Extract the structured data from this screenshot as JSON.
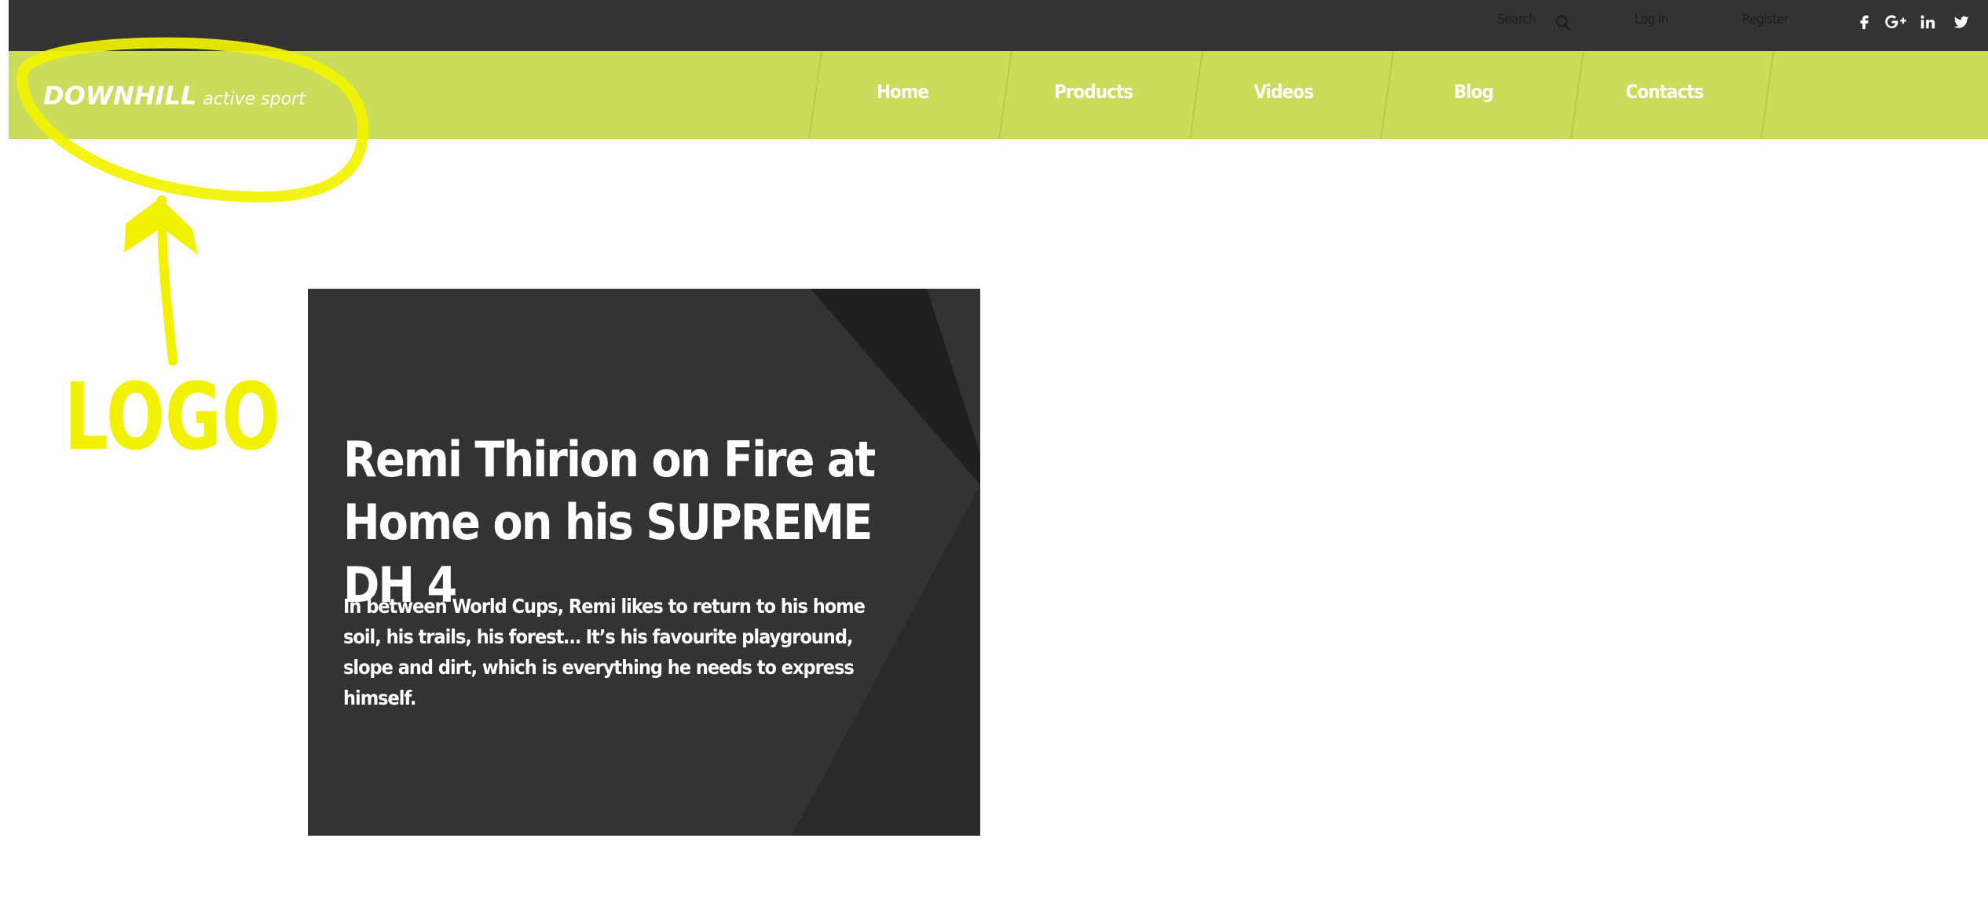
{
  "topbar": {
    "search_label": "Search",
    "login_label": "Log in",
    "register_label": "Register",
    "social_icons": [
      "facebook-icon",
      "google-plus-icon",
      "linkedin-icon",
      "twitter-icon"
    ]
  },
  "brand": {
    "name": "DOWNHILL",
    "tagline": "active sport"
  },
  "nav": {
    "items": [
      {
        "label": "Home"
      },
      {
        "label": "Products"
      },
      {
        "label": "Videos"
      },
      {
        "label": "Blog"
      },
      {
        "label": "Contacts"
      }
    ]
  },
  "annotation": {
    "label": "LOGO",
    "color": "#f5f500"
  },
  "card": {
    "title": "Remi Thirion on Fire at Home on his SUPREME DH 4",
    "body": "In between World Cups, Remi likes to return to his home soil, his trails, his forest… It’s his favourite playground, slope and dirt, which is everything he needs to express himself."
  },
  "colors": {
    "topbar_bg": "#333333",
    "nav_bg": "#cbdc5a",
    "card_bg": "#333333",
    "card_accent_dark": "#1f1f1f"
  }
}
